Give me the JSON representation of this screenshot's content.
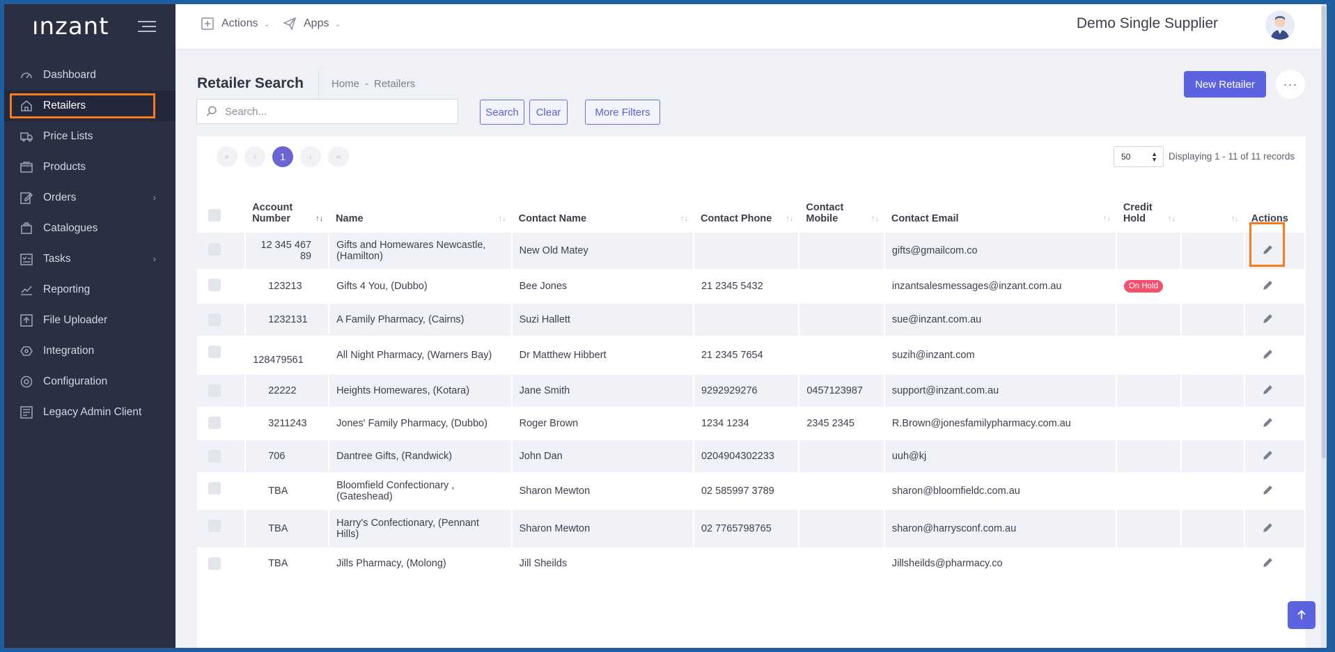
{
  "app": {
    "logo": "ınzant",
    "tenant_name": "Demo Single Supplier"
  },
  "topbar": {
    "actions_label": "Actions",
    "apps_label": "Apps"
  },
  "sidebar": {
    "items": [
      {
        "label": "Dashboard",
        "icon": "dashboard-icon"
      },
      {
        "label": "Retailers",
        "icon": "home-icon",
        "active": true
      },
      {
        "label": "Price Lists",
        "icon": "truck-icon"
      },
      {
        "label": "Products",
        "icon": "box-icon"
      },
      {
        "label": "Orders",
        "icon": "edit-icon",
        "has_children": true
      },
      {
        "label": "Catalogues",
        "icon": "catalogue-icon"
      },
      {
        "label": "Tasks",
        "icon": "tasks-icon",
        "has_children": true
      },
      {
        "label": "Reporting",
        "icon": "chart-icon"
      },
      {
        "label": "File Uploader",
        "icon": "upload-icon"
      },
      {
        "label": "Integration",
        "icon": "integration-icon"
      },
      {
        "label": "Configuration",
        "icon": "gear-icon"
      },
      {
        "label": "Legacy Admin Client",
        "icon": "list-icon"
      }
    ]
  },
  "page": {
    "title": "Retailer Search",
    "breadcrumb_home": "Home",
    "breadcrumb_sep": "-",
    "breadcrumb_current": "Retailers",
    "new_button": "New Retailer",
    "more_button": "···"
  },
  "search": {
    "placeholder": "Search...",
    "value": "",
    "search_button": "Search",
    "clear_button": "Clear",
    "more_filters_button": "More Filters"
  },
  "pagination": {
    "current_page": "1",
    "page_size": "50",
    "displaying": "Displaying 1 - 11 of 11 records"
  },
  "table": {
    "headers": [
      "Account Number",
      "Name",
      "Contact Name",
      "Contact Phone",
      "Contact Mobile",
      "Contact Email",
      "Credit Hold",
      "",
      "Actions"
    ],
    "rows": [
      {
        "account": "12 345 467 89",
        "name": "Gifts and Homewares Newcastle, (Hamilton)",
        "contact": "New Old Matey",
        "phone": "",
        "mobile": "",
        "email": "gifts@gmailcom.co",
        "hold": ""
      },
      {
        "account": "123213",
        "name": "Gifts 4 You, (Dubbo)",
        "contact": "Bee Jones",
        "phone": "21 2345 5432",
        "mobile": "",
        "email": "inzantsalesmessages@inzant.com.au",
        "hold": "On Hold"
      },
      {
        "account": "1232131",
        "name": "A Family Pharmacy, (Cairns)",
        "contact": "Suzi Hallett",
        "phone": "",
        "mobile": "",
        "email": "sue@inzant.com.au",
        "hold": ""
      },
      {
        "account": "128479561",
        "name": "All Night Pharmacy, (Warners Bay)",
        "contact": "Dr Matthew Hibbert",
        "phone": "21 2345 7654",
        "mobile": "",
        "email": "suzih@inzant.com",
        "hold": ""
      },
      {
        "account": "22222",
        "name": "Heights Homewares, (Kotara)",
        "contact": "Jane Smith",
        "phone": "9292929276",
        "mobile": "0457123987",
        "email": "support@inzant.com.au",
        "hold": ""
      },
      {
        "account": "3211243",
        "name": "Jones' Family Pharmacy, (Dubbo)",
        "contact": "Roger Brown",
        "phone": "1234 1234",
        "mobile": "2345 2345",
        "email": "R.Brown@jonesfamilypharmacy.com.au",
        "hold": ""
      },
      {
        "account": "706",
        "name": "Dantree Gifts, (Randwick)",
        "contact": "John Dan",
        "phone": "0204904302233",
        "mobile": "",
        "email": "uuh@kj",
        "hold": ""
      },
      {
        "account": "TBA",
        "name": "Bloomfield Confectionary , (Gateshead)",
        "contact": "Sharon Mewton",
        "phone": "02 585997 3789",
        "mobile": "",
        "email": "sharon@bloomfieldc.com.au",
        "hold": ""
      },
      {
        "account": "TBA",
        "name": "Harry's Confectionary, (Pennant Hills)",
        "contact": "Sharon Mewton",
        "phone": "02 7765798765",
        "mobile": "",
        "email": "sharon@harrysconf.com.au",
        "hold": ""
      },
      {
        "account": "TBA",
        "name": "Jills Pharmacy, (Molong)",
        "contact": "Jill Sheilds",
        "phone": "",
        "mobile": "",
        "email": "Jillsheilds@pharmacy.co",
        "hold": ""
      }
    ]
  },
  "colors": {
    "accent": "#5b63e0",
    "sidebar_bg": "#2b2f42",
    "highlight": "#f57c19",
    "on_hold": "#f4506d"
  }
}
